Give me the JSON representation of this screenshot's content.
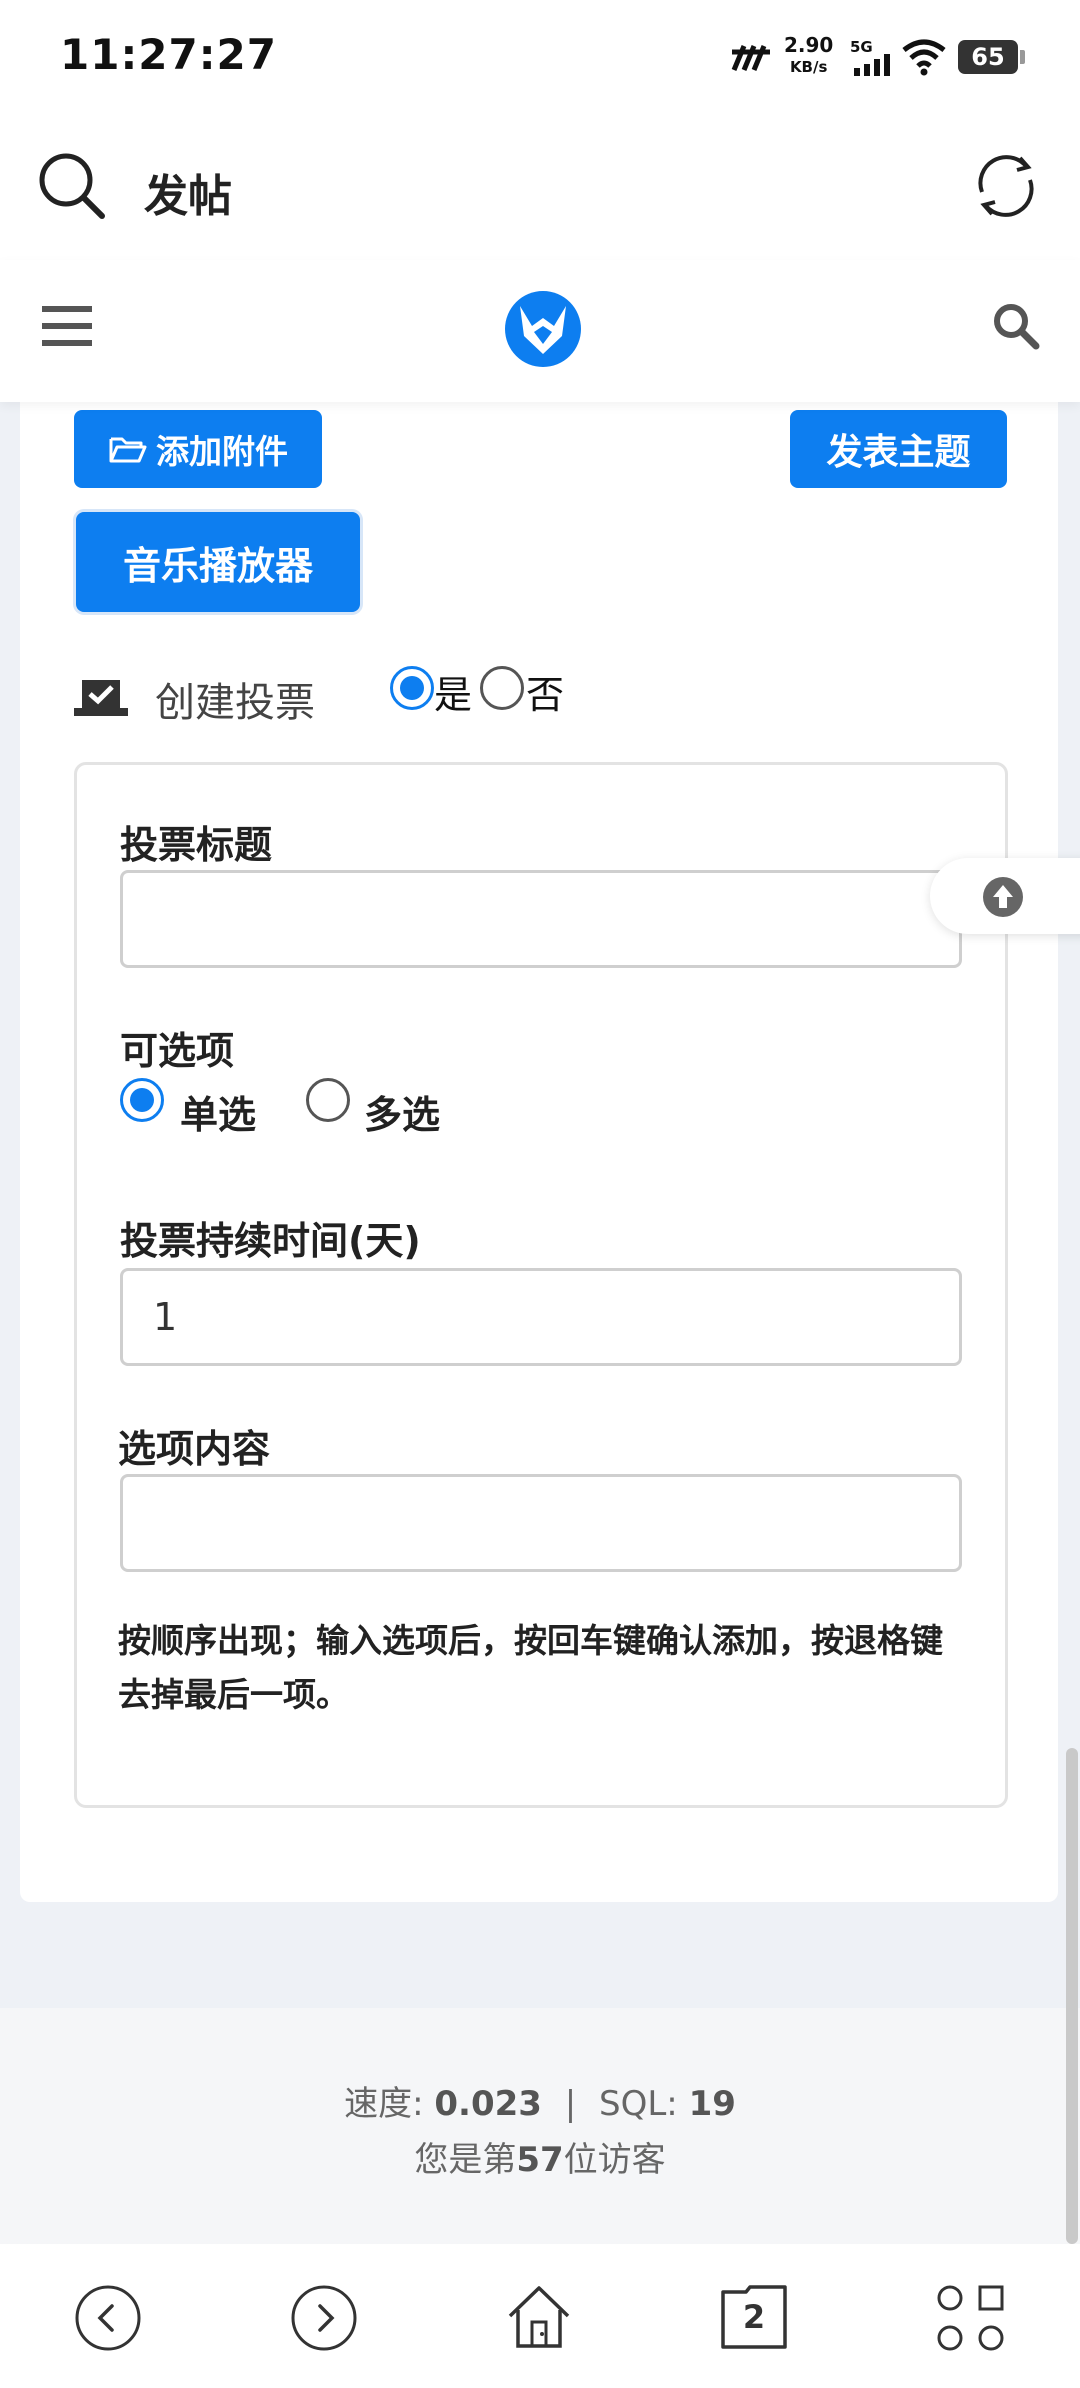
{
  "status_bar": {
    "time": "11:27:27",
    "net_speed": "2.90",
    "net_unit": "KB/s",
    "network": "5G",
    "battery": "65"
  },
  "browser": {
    "title": "发帖"
  },
  "toolbar": {
    "attach_label": "添加附件",
    "publish_label": "发表主题",
    "music_label": "音乐播放器"
  },
  "vote": {
    "label": "创建投票",
    "yes_label": "是",
    "no_label": "否",
    "create_selected": "是",
    "title_label": "投票标题",
    "title_value": "",
    "options_label": "可选项",
    "single_label": "单选",
    "multi_label": "多选",
    "choice_selected": "单选",
    "duration_label": "投票持续时间(天)",
    "duration_value": "1",
    "content_label": "选项内容",
    "content_value": "",
    "hint": "按顺序出现；输入选项后，按回车键确认添加，按退格键去掉最后一项。"
  },
  "footer": {
    "speed_label": "速度:",
    "speed_value": "0.023",
    "separator": "|",
    "sql_label": "SQL:",
    "sql_value": "19",
    "visitor_prefix": "您是第",
    "visitor_count": "57",
    "visitor_suffix": "位访客"
  },
  "bottom_nav": {
    "tab_count": "2"
  },
  "colors": {
    "accent": "#0d7ef0",
    "background": "#eef1f6",
    "card": "#ffffff"
  },
  "icons": [
    "search-icon",
    "refresh-icon",
    "menu-icon",
    "site-logo-icon",
    "nav-search-icon",
    "folder-icon",
    "vote-icon",
    "arrow-up-icon",
    "back-icon",
    "forward-icon",
    "home-icon",
    "tabs-icon",
    "apps-icon"
  ]
}
